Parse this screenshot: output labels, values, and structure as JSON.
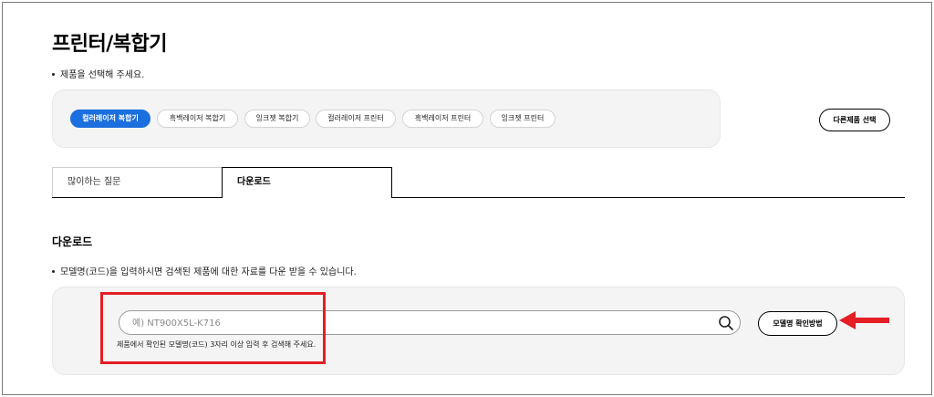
{
  "page": {
    "title": "프린터/복합기",
    "select_notice": "제품을 선택해 주세요."
  },
  "product_types": {
    "items": [
      {
        "label": "컬러레이저 복합기",
        "active": true
      },
      {
        "label": "흑백레이저 복합기",
        "active": false
      },
      {
        "label": "잉크젯 복합기",
        "active": false
      },
      {
        "label": "컬러레이저 프린터",
        "active": false
      },
      {
        "label": "흑백레이저 프린터",
        "active": false
      },
      {
        "label": "잉크젯 프린터",
        "active": false
      }
    ],
    "other_button_label": "다른제품 선택"
  },
  "tabs": [
    {
      "label": "많이하는 질문",
      "active": false
    },
    {
      "label": "다운로드",
      "active": true
    }
  ],
  "download": {
    "section_title": "다운로드",
    "notice": "모델명(코드)을 입력하시면 검색된 제품에 대한 자료를 다운 받을 수 있습니다.",
    "search": {
      "value": "",
      "placeholder": "예) NT900X5L-K716"
    },
    "hint": "제품에서 확인된 모델명(코드) 3자리 이상 입력 후 검색해 주세요.",
    "model_check_button_label": "모델명 확인방법"
  },
  "colors": {
    "accent": "#1b6fde",
    "annotation_red": "#e41e25"
  },
  "icons": {
    "search": "search-icon",
    "annotation_arrow": "arrow-left-icon"
  }
}
